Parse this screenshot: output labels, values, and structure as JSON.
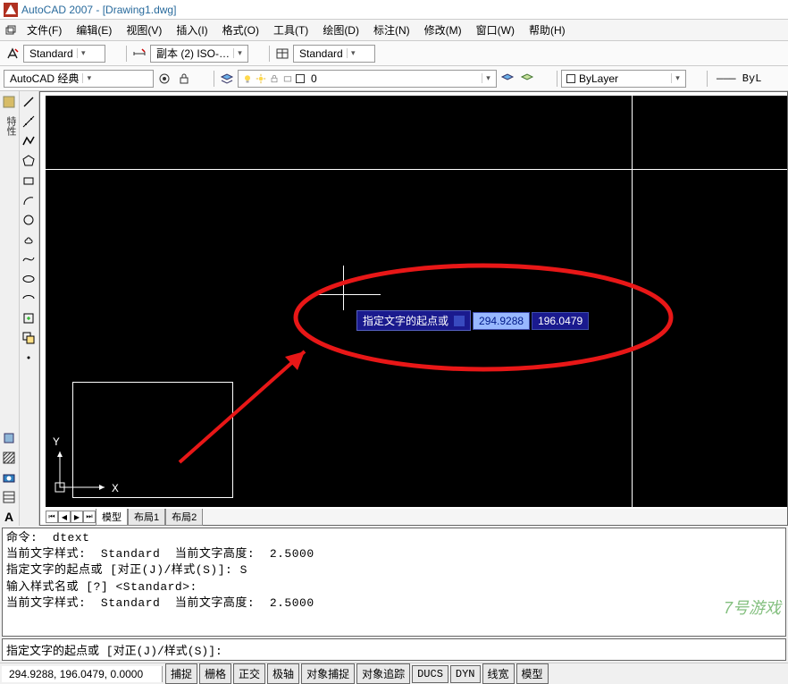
{
  "title": "AutoCAD 2007 - [Drawing1.dwg]",
  "menu": [
    "文件(F)",
    "编辑(E)",
    "视图(V)",
    "插入(I)",
    "格式(O)",
    "工具(T)",
    "绘图(D)",
    "标注(N)",
    "修改(M)",
    "窗口(W)",
    "帮助(H)"
  ],
  "toolbar1": {
    "style_dd": "Standard",
    "dim_dd": "副本 (2) ISO-…",
    "table_dd": "Standard"
  },
  "toolbar2": {
    "workspace_dd": "AutoCAD 经典",
    "layer_dd": "0",
    "bylayer_dd": "ByLayer",
    "byla_suffix": "——— ByL"
  },
  "props_label": "特性",
  "tabs": {
    "t0": "模型",
    "t1": "布局1",
    "t2": "布局2"
  },
  "prompt": {
    "text": "指定文字的起点或",
    "x": "294.9288",
    "y": "196.0479"
  },
  "ucs": {
    "x": "X",
    "y": "Y"
  },
  "cmd": {
    "l1": "命令:  dtext",
    "l2": "当前文字样式:  Standard  当前文字高度:  2.5000",
    "l3": "指定文字的起点或 [对正(J)/样式(S)]: S",
    "l4": "输入样式名或 [?] <Standard>:",
    "l5": "当前文字样式:  Standard  当前文字高度:  2.5000",
    "input": "指定文字的起点或 [对正(J)/样式(S)]:"
  },
  "status": {
    "coords": "294.9288, 196.0479, 0.0000",
    "btns": [
      "捕捉",
      "栅格",
      "正交",
      "极轴",
      "对象捕捉",
      "对象追踪",
      "DUCS",
      "DYN",
      "线宽",
      "模型"
    ]
  },
  "watermark": "7号游戏"
}
